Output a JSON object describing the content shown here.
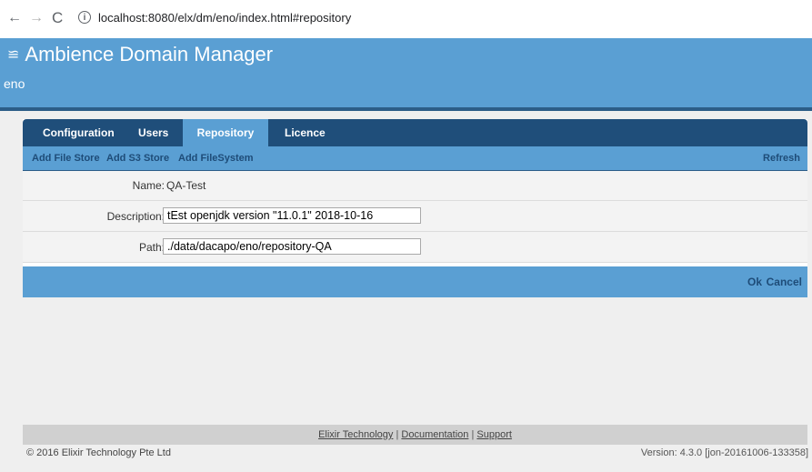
{
  "browser": {
    "back_glyph": "←",
    "forward_glyph": "→",
    "reload_glyph": "C",
    "info_glyph": "i",
    "url": "localhost:8080/elx/dm/eno/index.html#repository"
  },
  "app": {
    "title": "Ambience Domain Manager",
    "menu_glyph": "≌",
    "domain": "eno"
  },
  "tabs": [
    {
      "label": "Configuration",
      "active": false
    },
    {
      "label": "Users",
      "active": false
    },
    {
      "label": "Repository",
      "active": true
    },
    {
      "label": "Licence",
      "active": false
    }
  ],
  "toolbar": {
    "add_file_store": "Add File Store",
    "add_s3_store": "Add S3 Store",
    "add_filesystem": "Add FileSystem",
    "refresh": "Refresh"
  },
  "form": {
    "name_label": "Name:",
    "name_value": "QA-Test",
    "description_label": "Description:",
    "description_value": "tEst openjdk version \"11.0.1\" 2018-10-16",
    "path_label": "Path:",
    "path_value": "./data/dacapo/eno/repository-QA"
  },
  "actions": {
    "ok": "Ok",
    "cancel": "Cancel"
  },
  "footer": {
    "link1": "Elixir Technology",
    "separator1": "|",
    "link2": "Documentation",
    "separator2": "|",
    "link3": "Support",
    "copyright": "© 2016 Elixir Technology Pte Ltd",
    "version": "Version: 4.3.0 [jon-20161006-133358]"
  },
  "colors": {
    "header_blue": "#5a9fd3",
    "tabbar_navy": "#1f4e7a",
    "link_text": "#1e4c78"
  }
}
